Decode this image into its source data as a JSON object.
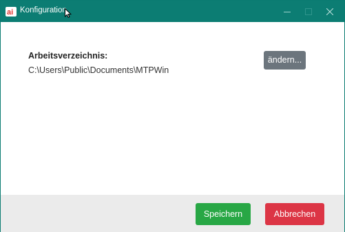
{
  "window": {
    "title": "Konfiguration",
    "app_icon_text": "ai",
    "title_bar_color": "#0c7d73"
  },
  "content": {
    "working_dir_label": "Arbeitsverzeichnis:",
    "working_dir_path": "C:\\Users\\Public\\Documents\\MTPWin",
    "change_button_label": "ändern..."
  },
  "footer": {
    "save_label": "Speichern",
    "cancel_label": "Abbrechen"
  },
  "colors": {
    "change_button": "#6c757d",
    "save_button": "#28a745",
    "cancel_button": "#dc3545",
    "footer_bg": "#ebebeb"
  },
  "icons": {
    "app": "app-logo-icon",
    "minimize": "minimize-icon",
    "maximize": "maximize-icon",
    "close": "close-icon",
    "cursor": "mouse-cursor-icon"
  }
}
